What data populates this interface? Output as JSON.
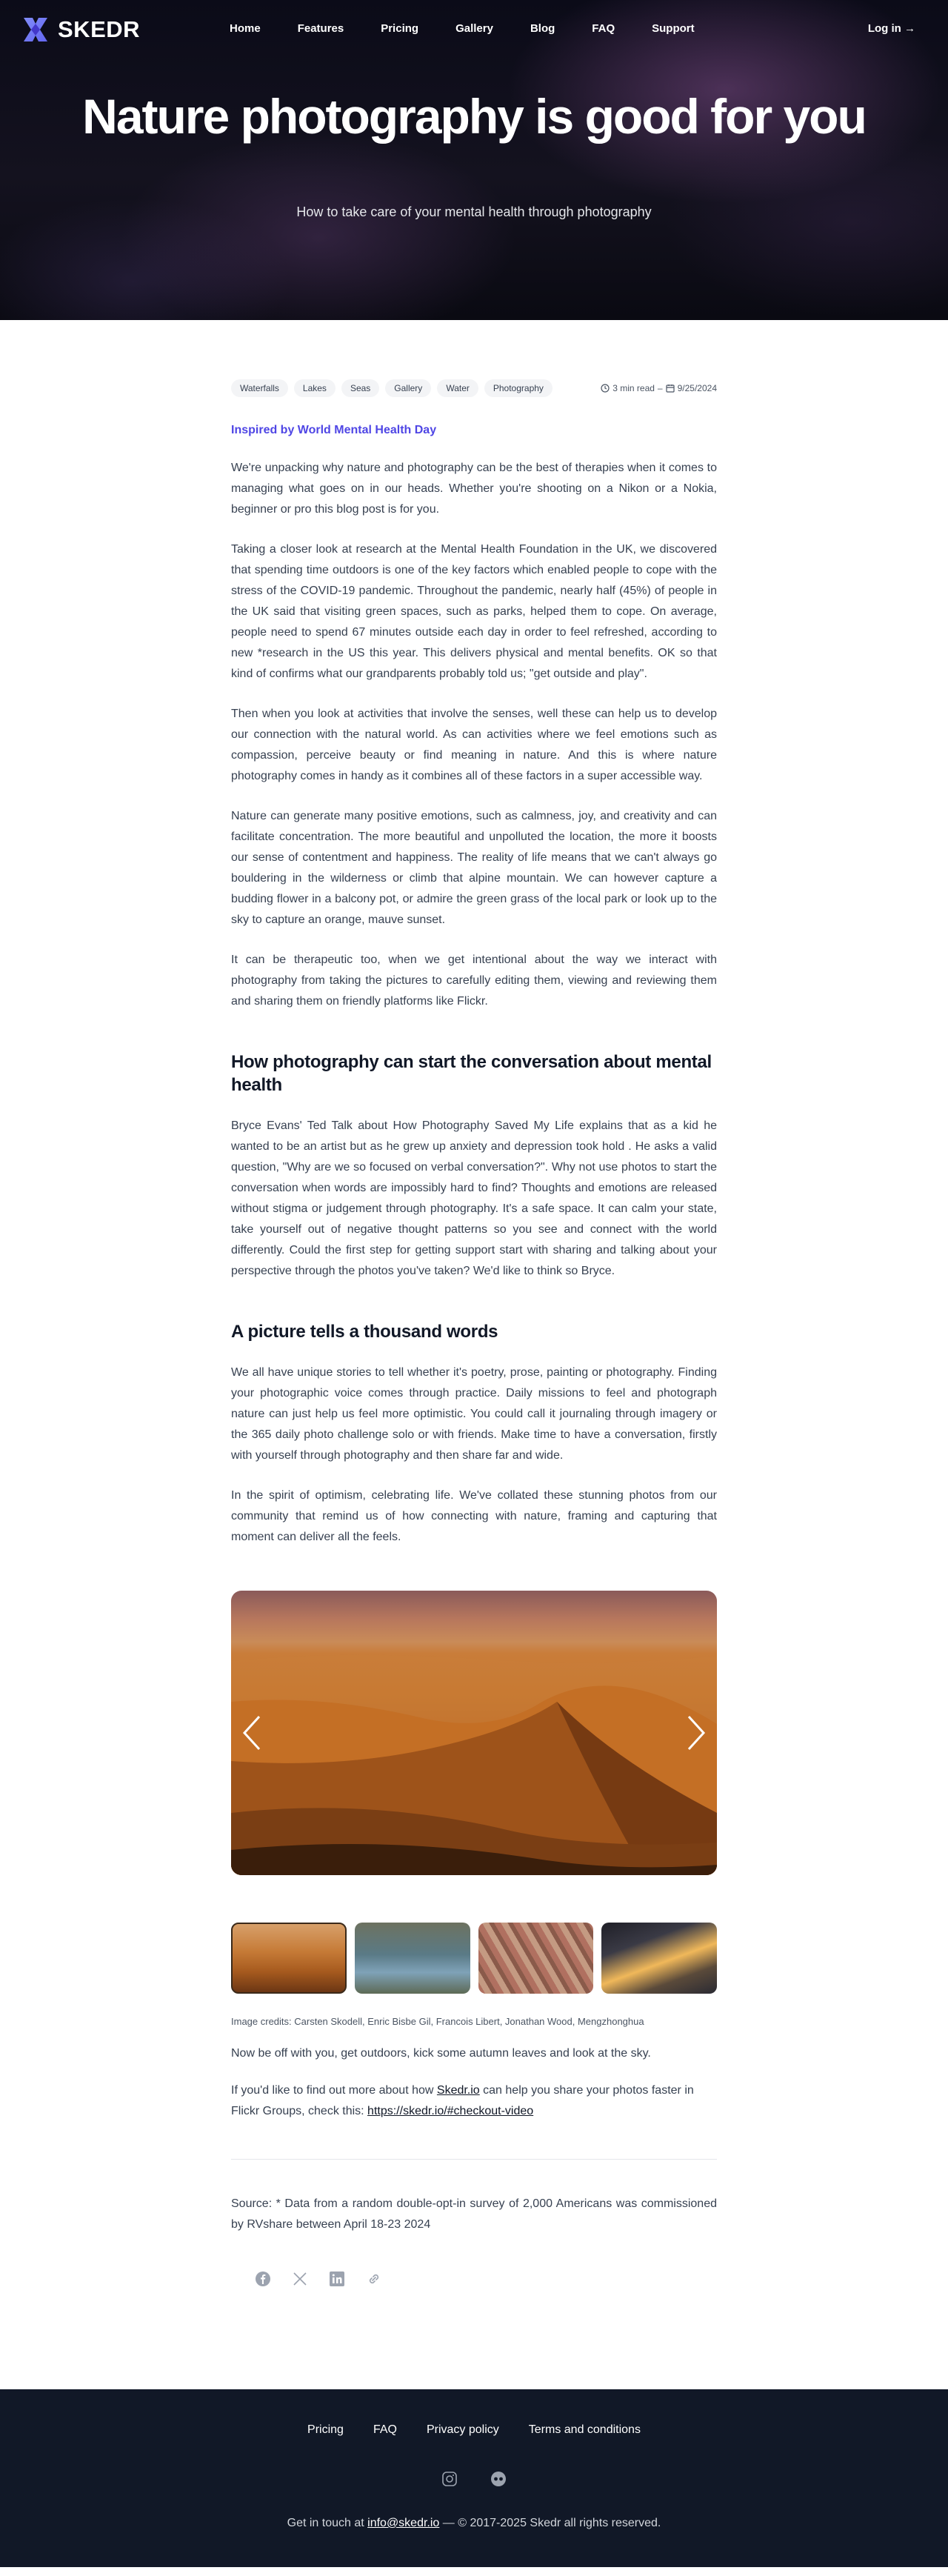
{
  "brand": {
    "name": "SKEDR",
    "accent": "#4f46e5"
  },
  "nav": {
    "items": [
      "Home",
      "Features",
      "Pricing",
      "Gallery",
      "Blog",
      "FAQ",
      "Support"
    ],
    "login": "Log in →"
  },
  "hero": {
    "title": "Nature photography is good for you",
    "subtitle": "How to take care of your mental health through photography"
  },
  "article": {
    "tags": [
      "Waterfalls",
      "Lakes",
      "Seas",
      "Gallery",
      "Water",
      "Photography"
    ],
    "read_time": "3 min read",
    "date": "9/25/2024",
    "eyebrow": "Inspired by World Mental Health Day",
    "intro": [
      "We're unpacking why nature and photography can be the best of therapies when it comes to managing what goes on in our heads. Whether you're shooting on a Nikon or a Nokia, beginner or pro this blog post is for you.",
      "Taking a closer look at research at the Mental Health Foundation in the UK, we discovered that spending time outdoors is one of the key factors which enabled people to cope with the stress of the COVID-19 pandemic. Throughout the pandemic, nearly half (45%) of people in the UK said that visiting green spaces, such as parks, helped them to cope. On average, people need to spend 67 minutes outside each day in order to feel refreshed, according to new *research in the US this year. This delivers physical and mental benefits. OK so that kind of confirms what our grandparents probably told us; \"get outside and play\".",
      "Then when you look at activities that involve the senses, well these can help us to develop our connection with the natural world. As can activities where we feel emotions such as compassion, perceive beauty or find meaning in nature. And this is where nature photography comes in handy as it combines all of these factors in a super accessible way.",
      "Nature can generate many positive emotions, such as calmness, joy, and creativity and can facilitate concentration. The more beautiful and unpolluted the location, the more it boosts our sense of contentment and happiness. The reality of life means that we can't always go bouldering in the wilderness or climb that alpine mountain. We can however capture a budding flower in a balcony pot, or admire the green grass of the local park or look up to the sky to capture an orange, mauve sunset.",
      "It can be therapeutic too, when we get intentional about the way we interact with photography from taking the pictures to carefully editing them, viewing and reviewing them and sharing them on friendly platforms like Flickr."
    ],
    "section1": {
      "heading": "How photography can start the conversation about mental health",
      "body": "Bryce Evans' Ted Talk about How Photography Saved My Life explains that as a kid he wanted to be an artist but as he grew up anxiety and depression took hold . He asks a valid question, \"Why are we so focused on verbal conversation?\". Why not use photos to start the conversation when words are impossibly hard to find? Thoughts and emotions are released without stigma or judgement through photography. It's a safe space. It can calm your state, take yourself out of negative thought patterns so you see and connect with the world differently. Could the first step for getting support start with sharing and talking about your perspective through the photos you've taken? We'd like to think so Bryce."
    },
    "section2": {
      "heading": "A picture tells a thousand words",
      "body1": "We all have unique stories to tell whether it's poetry, prose, painting or photography. Finding your photographic voice comes through practice. Daily missions to feel and photograph nature can just help us feel more optimistic. You could call it journaling through imagery or the 365 daily photo challenge solo or with friends. Make time to have a conversation, firstly with yourself through photography and then share far and wide.",
      "body2": "In the spirit of optimism, celebrating life. We've collated these stunning photos from our community that remind us of how connecting with nature, framing and capturing that moment can deliver all the feels."
    },
    "credits": "Image credits: Carsten Skodell, Enric Bisbe Gil, Francois Libert, Jonathan Wood, Mengzhonghua",
    "closing1": "Now be off with you, get outdoors, kick some autumn leaves and look at the sky.",
    "closing2_prefix": "If you'd like to find out more about how ",
    "closing2_link": "Skedr.io",
    "closing2_mid": " can help you share your photos faster in Flickr Groups, check this: ",
    "closing2_url": "https://skedr.io/#checkout-video",
    "source": "Source: * Data from a random double-opt-in survey of 2,000 Americans was commissioned by RVshare between April 18-23 2024"
  },
  "share": {
    "icons": [
      "facebook-icon",
      "x-icon",
      "linkedin-icon",
      "link-icon"
    ]
  },
  "footer": {
    "links": [
      "Pricing",
      "FAQ",
      "Privacy policy",
      "Terms and conditions"
    ],
    "icons": [
      "instagram-icon",
      "flickr-icon"
    ],
    "contact_prefix": "Get in touch at ",
    "email": "info@skedr.io",
    "copyright": " — © 2017-2025 Skedr all rights reserved."
  }
}
